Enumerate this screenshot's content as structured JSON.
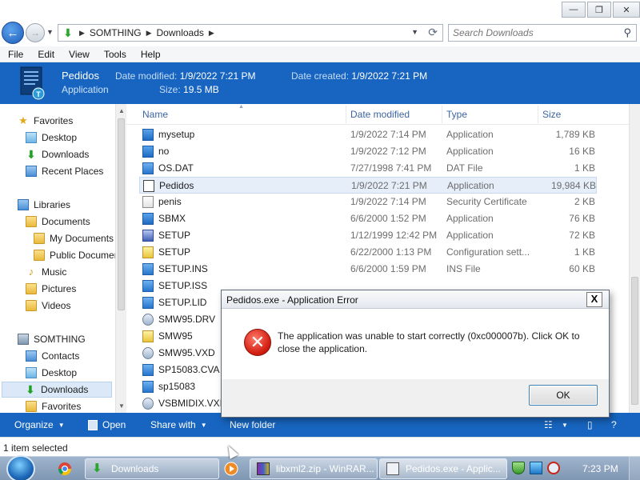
{
  "window": {
    "minimize_glyph": "—",
    "maximize_glyph": "❐",
    "close_glyph": "✕"
  },
  "address": {
    "back_glyph": "←",
    "forward_glyph": "→",
    "breadcrumb": [
      "SOMTHING",
      "Downloads"
    ],
    "search_placeholder": "Search Downloads"
  },
  "menu": [
    "File",
    "Edit",
    "View",
    "Tools",
    "Help"
  ],
  "details": {
    "name": "Pedidos",
    "type": "Application",
    "date_modified_label": "Date modified:",
    "date_modified": "1/9/2022 7:21 PM",
    "date_created_label": "Date created:",
    "date_created": "1/9/2022 7:21 PM",
    "size_label": "Size:",
    "size": "19.5 MB"
  },
  "nav": {
    "favorites": "Favorites",
    "desktop": "Desktop",
    "downloads": "Downloads",
    "recent_places": "Recent Places",
    "libraries": "Libraries",
    "documents": "Documents",
    "my_documents": "My Documents",
    "public_documents": "Public Documents",
    "music": "Music",
    "pictures": "Pictures",
    "videos": "Videos",
    "somthing": "SOMTHING",
    "contacts": "Contacts",
    "desktop2": "Desktop",
    "downloads2": "Downloads",
    "favorites2": "Favorites"
  },
  "columns": {
    "name": "Name",
    "date_modified": "Date modified",
    "type": "Type",
    "size": "Size"
  },
  "files": [
    {
      "name": "mysetup",
      "modified": "1/9/2022 7:14 PM",
      "type": "Application",
      "size": "1,789 KB",
      "icon": "app-icon"
    },
    {
      "name": "no",
      "modified": "1/9/2022 7:12 PM",
      "type": "Application",
      "size": "16 KB",
      "icon": "app-icon"
    },
    {
      "name": "OS.DAT",
      "modified": "7/27/1998 7:41 PM",
      "type": "DAT File",
      "size": "1 KB",
      "icon": "file-icon"
    },
    {
      "name": "Pedidos",
      "modified": "1/9/2022 7:21 PM",
      "type": "Application",
      "size": "19,984 KB",
      "icon": "app-icon"
    },
    {
      "name": "penis",
      "modified": "1/9/2022 7:14 PM",
      "type": "Security Certificate",
      "size": "2 KB",
      "icon": "certificate-icon"
    },
    {
      "name": "SBMX",
      "modified": "6/6/2000 1:52 PM",
      "type": "Application",
      "size": "76 KB",
      "icon": "app-icon"
    },
    {
      "name": "SETUP",
      "modified": "1/12/1999 12:42 PM",
      "type": "Application",
      "size": "72 KB",
      "icon": "setup-icon"
    },
    {
      "name": "SETUP",
      "modified": "6/22/2000 1:13 PM",
      "type": "Configuration sett...",
      "size": "1 KB",
      "icon": "config-icon"
    },
    {
      "name": "SETUP.INS",
      "modified": "6/6/2000 1:59 PM",
      "type": "INS File",
      "size": "60 KB",
      "icon": "file-icon"
    },
    {
      "name": "SETUP.ISS",
      "modified": "",
      "type": "",
      "size": "",
      "icon": "file-icon"
    },
    {
      "name": "SETUP.LID",
      "modified": "",
      "type": "",
      "size": "",
      "icon": "file-icon"
    },
    {
      "name": "SMW95.DRV",
      "modified": "",
      "type": "",
      "size": "",
      "icon": "driver-icon"
    },
    {
      "name": "SMW95",
      "modified": "",
      "type": "",
      "size": "",
      "icon": "config-icon"
    },
    {
      "name": "SMW95.VXD",
      "modified": "",
      "type": "",
      "size": "",
      "icon": "driver-icon"
    },
    {
      "name": "SP15083.CVA",
      "modified": "",
      "type": "",
      "size": "",
      "icon": "file-icon"
    },
    {
      "name": "sp15083",
      "modified": "",
      "type": "",
      "size": "",
      "icon": "file-icon"
    },
    {
      "name": "VSBMIDIX.VXD",
      "modified": "",
      "type": "",
      "size": "",
      "icon": "driver-icon"
    }
  ],
  "commands": {
    "organize": "Organize",
    "open": "Open",
    "share_with": "Share with",
    "new_folder": "New folder"
  },
  "status": "1 item selected",
  "taskbar": {
    "items": [
      "Downloads",
      "libxml2.zip - WinRAR...",
      "Pedidos.exe - Applic..."
    ],
    "clock": "7:23 PM"
  },
  "dialog": {
    "title": "Pedidos.exe - Application Error",
    "close_glyph": "X",
    "message": "The application was unable to start correctly (0xc000007b). Click OK to close the application.",
    "ok_label": "OK",
    "icon_glyph": "✕"
  },
  "colors": {
    "accent": "#1765c0",
    "error": "#d21f12",
    "selection": "#e5eef9"
  }
}
